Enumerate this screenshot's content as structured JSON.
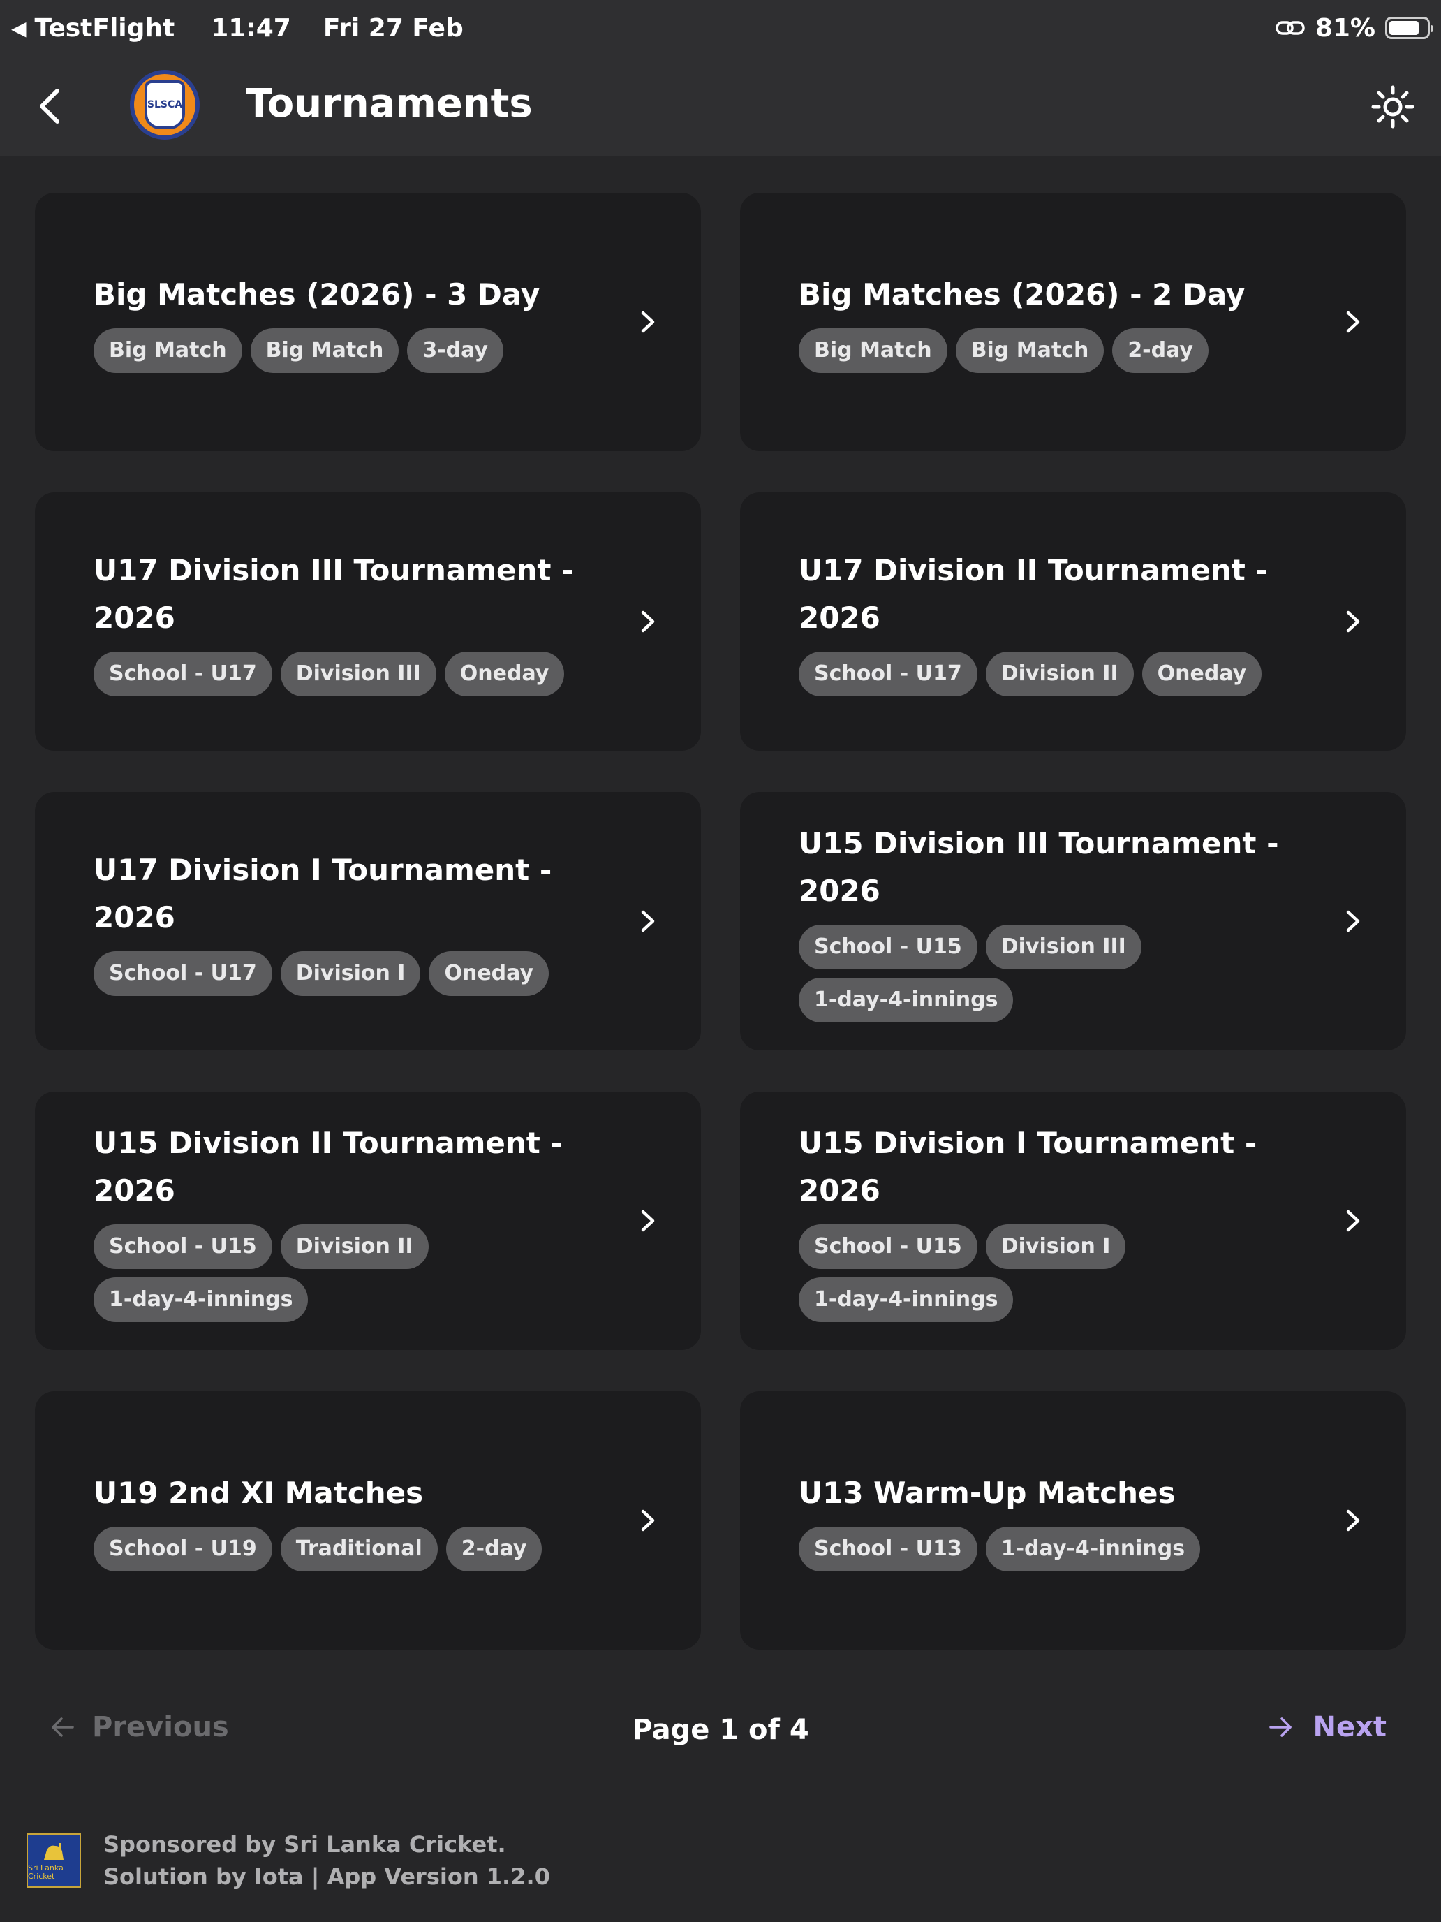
{
  "status_bar": {
    "back_app": "TestFlight",
    "time": "11:47",
    "date": "Fri 27 Feb",
    "battery": "81%",
    "battery_level": 0.81
  },
  "header": {
    "title": "Tournaments",
    "logo_text": "SLSCA"
  },
  "cards": [
    {
      "title": "Big Matches (2026) - 3 Day",
      "tags": [
        "Big Match",
        "Big Match",
        "3-day"
      ]
    },
    {
      "title": "Big Matches (2026) - 2 Day",
      "tags": [
        "Big Match",
        "Big Match",
        "2-day"
      ]
    },
    {
      "title": "U17 Division III Tournament - 2026",
      "tags": [
        "School - U17",
        "Division III",
        "Oneday"
      ]
    },
    {
      "title": "U17 Division II Tournament - 2026",
      "tags": [
        "School - U17",
        "Division II",
        "Oneday"
      ]
    },
    {
      "title": "U17 Division I Tournament - 2026",
      "tags": [
        "School - U17",
        "Division I",
        "Oneday"
      ]
    },
    {
      "title": "U15 Division III Tournament - 2026",
      "tags": [
        "School - U15",
        "Division III",
        "1-day-4-innings"
      ]
    },
    {
      "title": "U15 Division II Tournament - 2026",
      "tags": [
        "School - U15",
        "Division II",
        "1-day-4-innings"
      ]
    },
    {
      "title": "U15 Division I Tournament - 2026",
      "tags": [
        "School - U15",
        "Division I",
        "1-day-4-innings"
      ]
    },
    {
      "title": "U19 2nd XI Matches",
      "tags": [
        "School - U19",
        "Traditional",
        "2-day"
      ]
    },
    {
      "title": "U13 Warm-Up Matches",
      "tags": [
        "School - U13",
        "1-day-4-innings"
      ]
    }
  ],
  "pagination": {
    "previous_label": "Previous",
    "page_info": "Page 1 of 4",
    "next_label": "Next"
  },
  "footer": {
    "logo_text": "Sri Lanka Cricket",
    "line1": "Sponsored by Sri Lanka Cricket.",
    "line2": "Solution by Iota | App Version 1.2.0"
  },
  "colors": {
    "background": "#262628",
    "card": "#1c1c1e",
    "tag": "#5c5c5e",
    "next_accent": "#b9a3f0",
    "disabled": "#6b6b6e"
  }
}
